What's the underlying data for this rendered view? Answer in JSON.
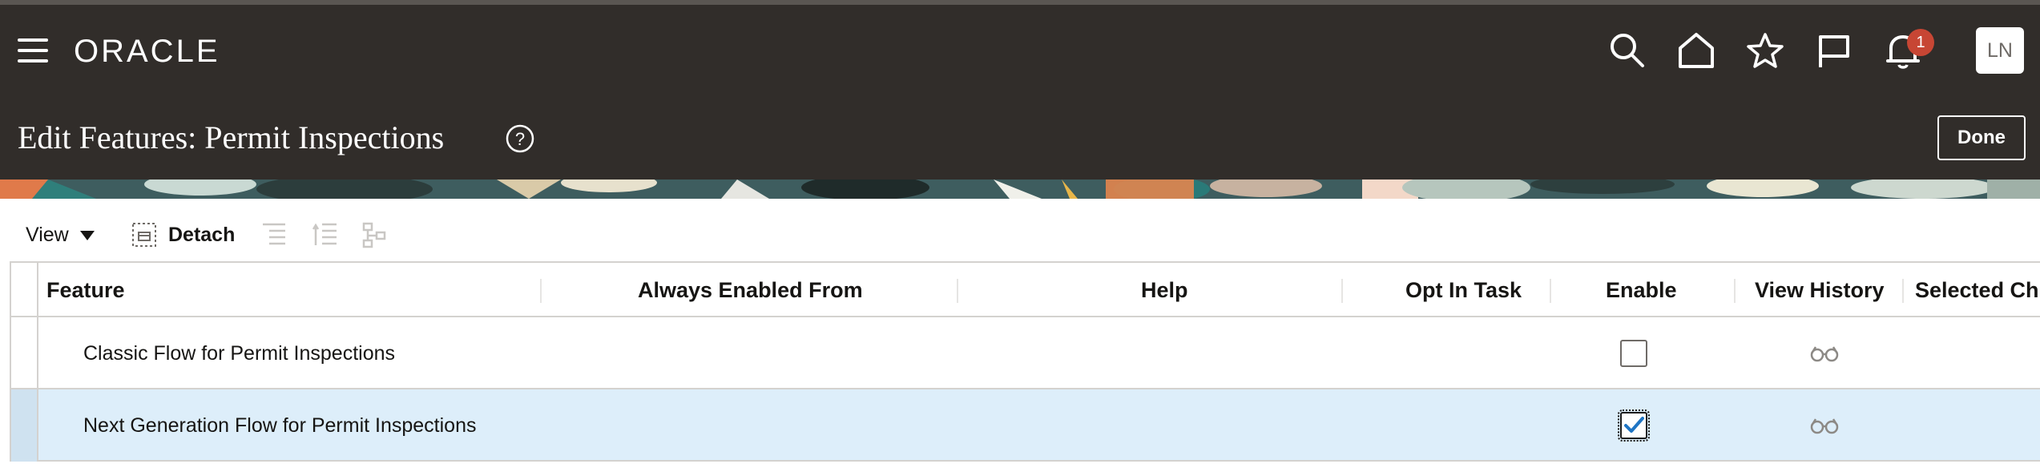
{
  "header": {
    "brand": "ORACLE",
    "notification_count": "1",
    "user_initials": "LN",
    "page_title": "Edit Features: Permit Inspections",
    "done_label": "Done",
    "icons": [
      "menu-icon",
      "search-icon",
      "home-icon",
      "favorites-star-icon",
      "flag-icon",
      "notifications-bell-icon",
      "help-icon"
    ]
  },
  "toolbar": {
    "view_label": "View",
    "detach_label": "Detach"
  },
  "table": {
    "columns": [
      "Feature",
      "Always Enabled From",
      "Help",
      "Opt In Task",
      "Enable",
      "View History",
      "Selected Ch"
    ],
    "rows": [
      {
        "feature": "Classic Flow for Permit Inspections",
        "enabled": false,
        "selected": false
      },
      {
        "feature": "Next Generation Flow for Permit Inspections",
        "enabled": true,
        "selected": true
      }
    ]
  },
  "colors": {
    "header_bg": "#312d2a",
    "selected_row_bg": "#ddeefa",
    "badge": "#c74634",
    "check": "#1f75c4"
  }
}
